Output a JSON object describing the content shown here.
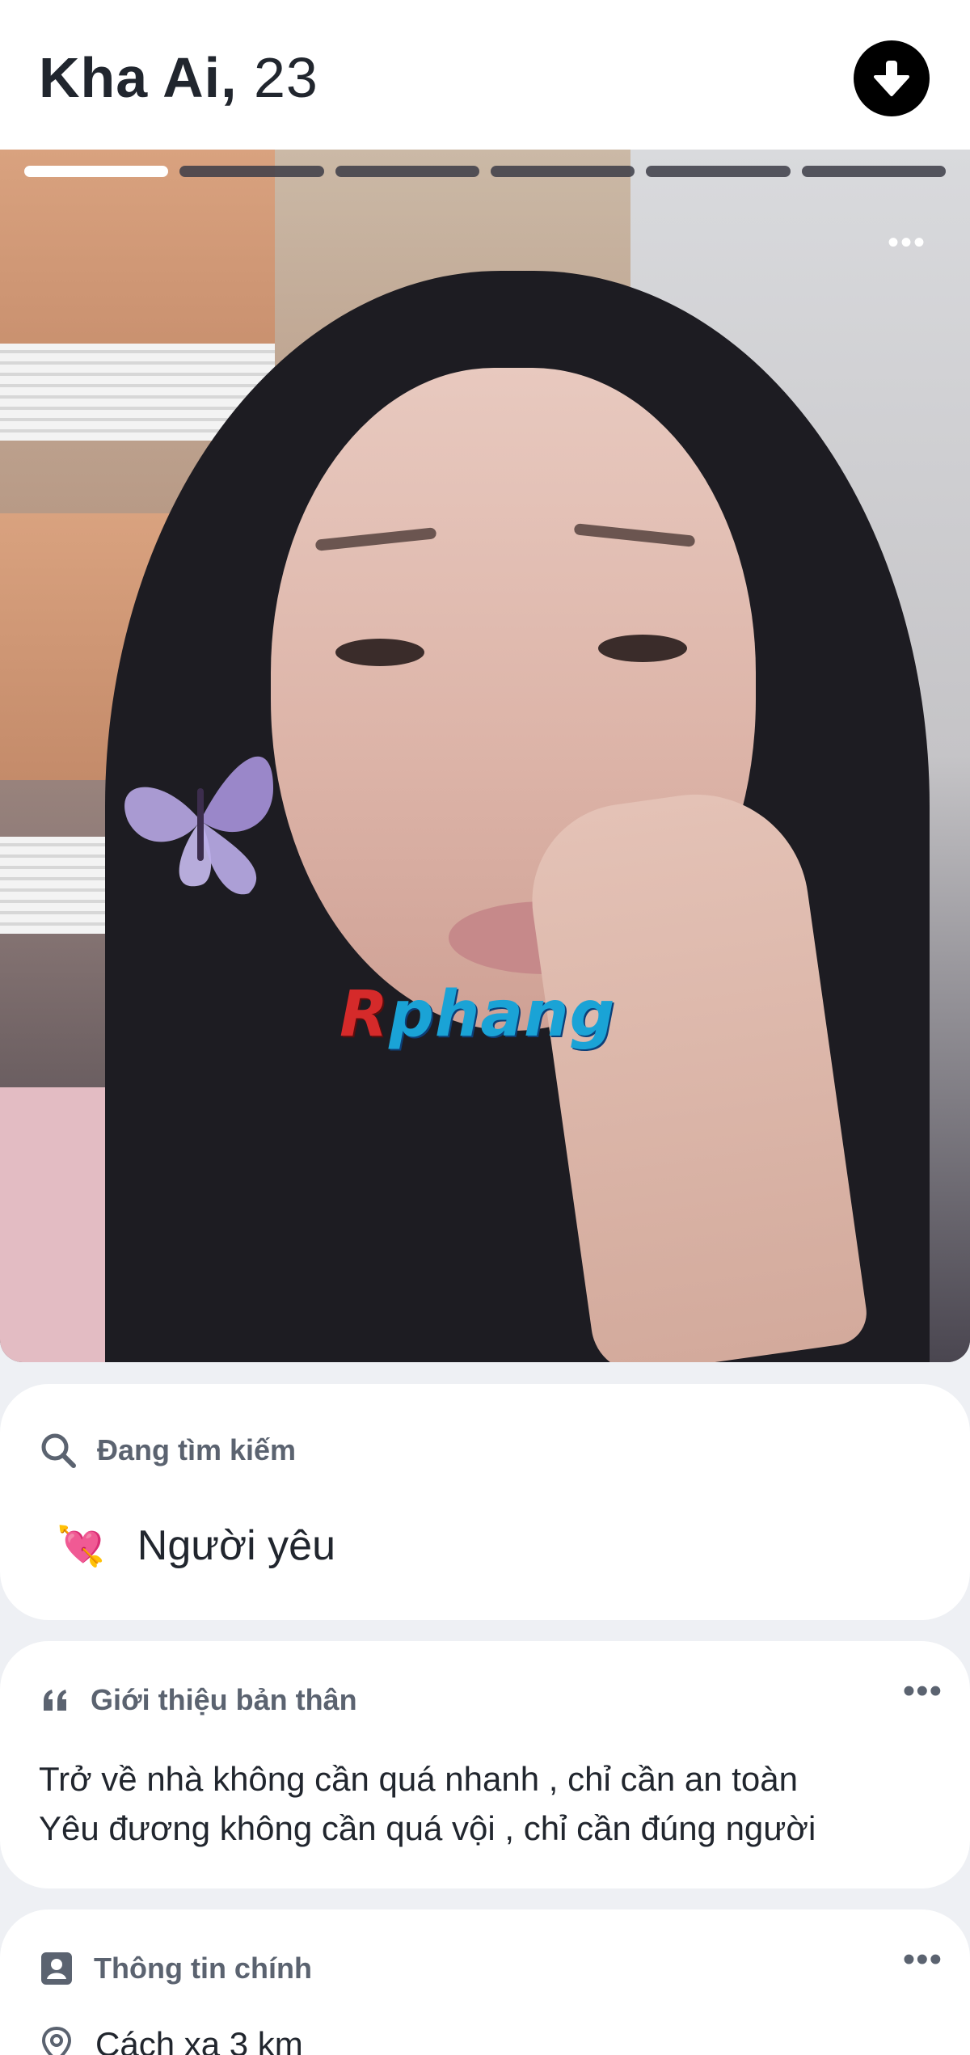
{
  "profile": {
    "name": "Kha Ai,",
    "age": "23"
  },
  "photo": {
    "count": 6,
    "active_index": 0,
    "watermark_prefix": "R",
    "watermark_rest": "phang",
    "more_label": "•••"
  },
  "looking_for": {
    "heading": "Đang tìm kiếm",
    "emoji": "💘",
    "value": "Người yêu"
  },
  "about": {
    "heading": "Giới thiệu bản thân",
    "lines": [
      "Trở về nhà không cần quá nhanh , chỉ cần an toàn",
      "Yêu đương không cần quá vội , chỉ cần đúng người"
    ],
    "more_label": "•••"
  },
  "basics": {
    "heading": "Thông tin chính",
    "distance": "Cách xa 3 km",
    "more_label": "•••"
  },
  "icons": {
    "download": "download-arrow-icon",
    "search": "search-icon",
    "quote": "quote-icon",
    "id_card": "profile-card-icon",
    "location": "location-pin-icon"
  }
}
